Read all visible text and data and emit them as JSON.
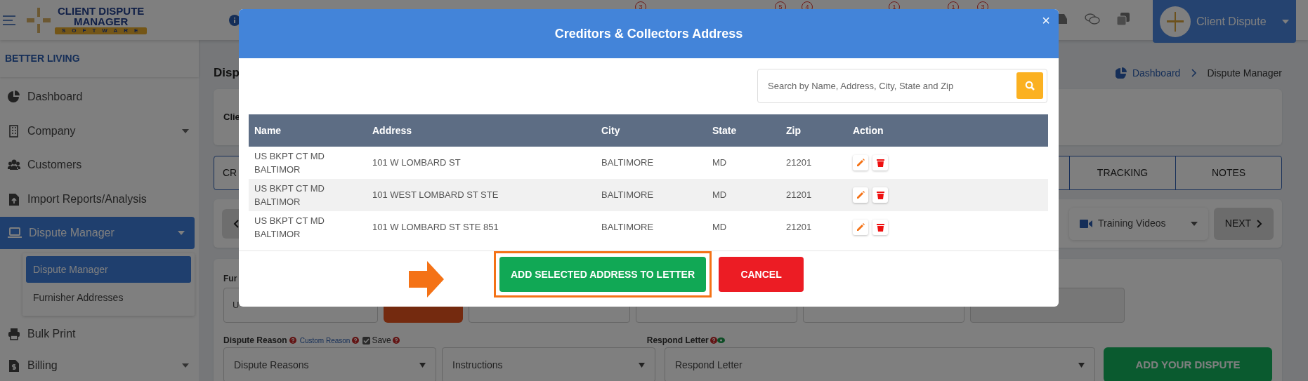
{
  "header": {
    "logo": [
      "CLIENT DISPUTE",
      "MANAGER",
      "SOFTWARE"
    ],
    "badges": [
      "3",
      "5",
      "4",
      "1",
      "1",
      "3"
    ],
    "user": "Client Dispute"
  },
  "sidebar": {
    "company": "BETTER LIVING",
    "items": [
      {
        "label": "Dashboard",
        "selected": false
      },
      {
        "label": "Company",
        "selected": false,
        "submenu": true
      },
      {
        "label": "Customers",
        "selected": false
      },
      {
        "label": "Import Reports/Analysis",
        "selected": false
      },
      {
        "label": "Dispute Manager",
        "selected": true,
        "submenu": true,
        "children": [
          {
            "label": "Dispute Manager",
            "selected": true
          },
          {
            "label": "Furnisher Addresses",
            "selected": false
          }
        ]
      },
      {
        "label": "Bulk Print",
        "selected": false
      },
      {
        "label": "Billing",
        "selected": false,
        "submenu": true
      }
    ]
  },
  "page": {
    "title": "Disp",
    "breadcrumb": [
      {
        "label": "Dashboard",
        "kind": "link"
      },
      {
        "label": "Dispute Manager",
        "kind": "current"
      }
    ],
    "client_label": "Clie",
    "tabs": [
      "CR",
      "TRACKING",
      "NOTES"
    ],
    "training_videos": "Training Videos",
    "next": "NEXT",
    "furnisher_label": "Fur",
    "furnisher_value": "U",
    "dispute_reason_label": "Dispute Reason",
    "custom_reason_link": "Custom Reason",
    "save": {
      "label": "Save",
      "checked": true
    },
    "respond_letter_label": "Respond Letter",
    "selects": [
      "Dispute Reasons",
      "Instructions",
      "Respond Letter"
    ],
    "add_dispute": "ADD YOUR DISPUTE"
  },
  "modal": {
    "title": "Creditors & Collectors Address",
    "close": "×",
    "search": {
      "placeholder": "Search by Name, Address, City, State and Zip"
    },
    "table": {
      "columns": [
        "Name",
        "Address",
        "City",
        "State",
        "Zip",
        "Action"
      ],
      "rows": [
        [
          "US BKPT CT MD BALTIMOR",
          "101 W LOMBARD ST",
          "BALTIMORE",
          "MD",
          "21201"
        ],
        [
          "US BKPT CT MD BALTIMOR",
          "101 WEST LOMBARD ST STE",
          "BALTIMORE",
          "MD",
          "21201"
        ],
        [
          "US BKPT CT MD BALTIMOR",
          "101 W LOMBARD ST STE 851",
          "BALTIMORE",
          "MD",
          "21201"
        ]
      ]
    },
    "buttons": [
      {
        "label": "ADD SELECTED ADDRESS TO LETTER",
        "kind": "primary",
        "highlighted": true
      },
      {
        "label": "CANCEL",
        "kind": "cancel",
        "highlighted": false
      }
    ]
  }
}
